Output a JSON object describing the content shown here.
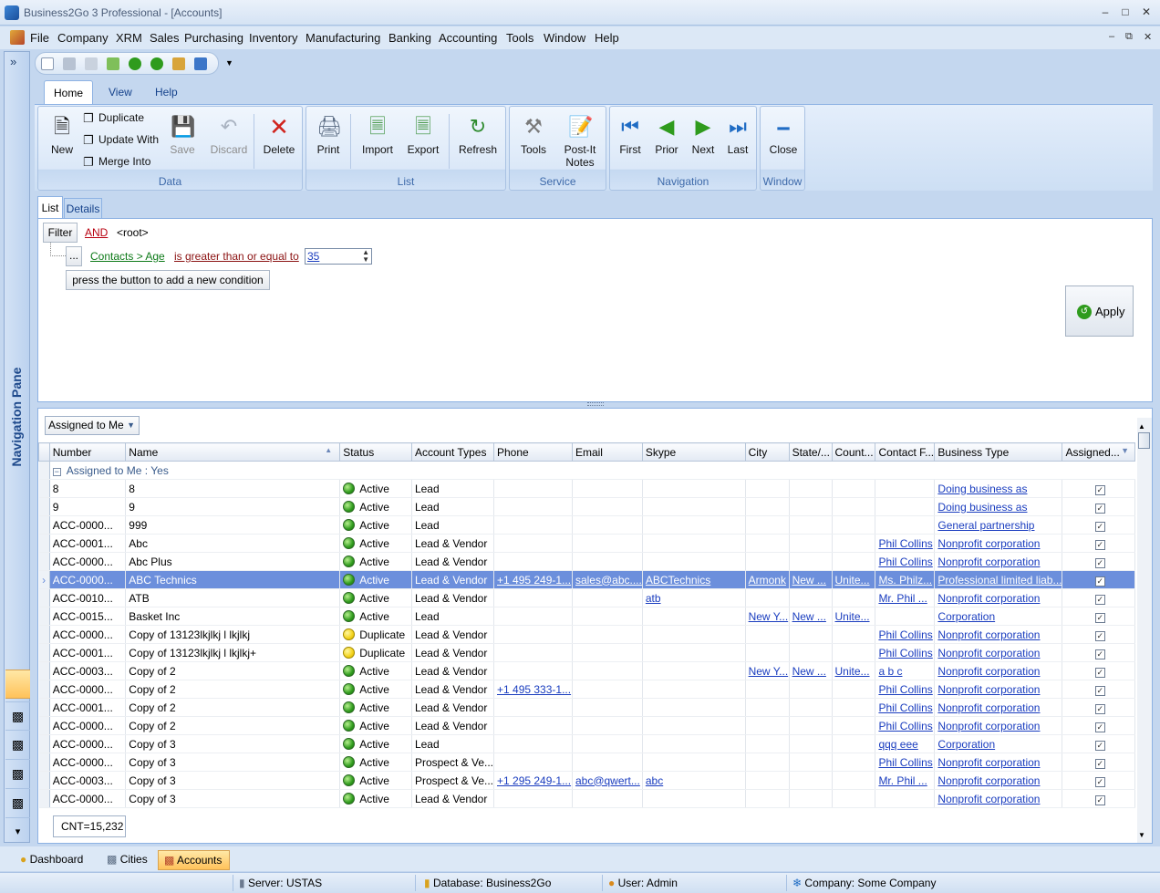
{
  "window": {
    "title": "Business2Go 3 Professional - [Accounts]",
    "min": "–",
    "max": "□",
    "close": "✕"
  },
  "menu": [
    "File",
    "Company",
    "XRM",
    "Sales",
    "Purchasing",
    "Inventory",
    "Manufacturing",
    "Banking",
    "Accounting",
    "Tools",
    "Window",
    "Help"
  ],
  "mdi": {
    "min": "–",
    "restore": "⧉",
    "close": "✕"
  },
  "nav_pane": {
    "label": "Navigation Pane",
    "expand": "»",
    "more": "▾"
  },
  "ribbon": {
    "tabs": [
      "Home",
      "View",
      "Help"
    ],
    "groups": {
      "data": {
        "label": "Data",
        "new": "New",
        "duplicate": "Duplicate",
        "update_with": "Update With",
        "merge_into": "Merge Into",
        "save": "Save",
        "discard": "Discard",
        "delete": "Delete"
      },
      "list": {
        "label": "List",
        "print": "Print",
        "import": "Import",
        "export": "Export",
        "refresh": "Refresh"
      },
      "service": {
        "label": "Service",
        "tools": "Tools",
        "postit_1": "Post-It",
        "postit_2": "Notes"
      },
      "navigation": {
        "label": "Navigation",
        "first": "First",
        "prior": "Prior",
        "next": "Next",
        "last": "Last"
      },
      "window": {
        "label": "Window",
        "close": "Close"
      }
    }
  },
  "view_tabs": {
    "list": "List",
    "details": "Details"
  },
  "filter": {
    "button": "Filter",
    "operator": "AND",
    "root": "<root>",
    "field": "Contacts > Age",
    "condition": "is greater than or equal to",
    "value": "35",
    "dots": "...",
    "add_condition": "press the button to add a new condition",
    "apply": "Apply"
  },
  "grid": {
    "group_dropdown": "Assigned to Me",
    "columns": [
      "Number",
      "Name",
      "Status",
      "Account Types",
      "Phone",
      "Email",
      "Skype",
      "City",
      "State/...",
      "Count...",
      "Contact F...",
      "Business Type",
      "Assigned..."
    ],
    "group_row": "Assigned to Me : Yes",
    "rows": [
      {
        "number": "8",
        "name": "8",
        "status": "Active",
        "types": "Lead",
        "phone": "",
        "email": "",
        "skype": "",
        "city": "",
        "state": "",
        "country": "",
        "contact": "",
        "business": "Doing business as"
      },
      {
        "number": "9",
        "name": "9",
        "status": "Active",
        "types": "Lead",
        "phone": "",
        "email": "",
        "skype": "",
        "city": "",
        "state": "",
        "country": "",
        "contact": "",
        "business": "Doing business as"
      },
      {
        "number": "ACC-0000...",
        "name": "999",
        "status": "Active",
        "types": "Lead",
        "phone": "",
        "email": "",
        "skype": "",
        "city": "",
        "state": "",
        "country": "",
        "contact": "",
        "business": "General partnership"
      },
      {
        "number": "ACC-0001...",
        "name": "Abc",
        "status": "Active",
        "types": "Lead & Vendor",
        "phone": "",
        "email": "",
        "skype": "",
        "city": "",
        "state": "",
        "country": "",
        "contact": "Phil Collins",
        "business": "Nonprofit corporation"
      },
      {
        "number": "ACC-0000...",
        "name": "Abc Plus",
        "status": "Active",
        "types": "Lead & Vendor",
        "phone": "",
        "email": "",
        "skype": "",
        "city": "",
        "state": "",
        "country": "",
        "contact": "Phil Collins",
        "business": "Nonprofit corporation"
      },
      {
        "number": "ACC-0000...",
        "name": "ABC Technics",
        "status": "Active",
        "types": "Lead & Vendor",
        "phone": "+1 495 249-1...",
        "email": "sales@abc....",
        "skype": "ABCTechnics",
        "city": "Armonk",
        "state": "New ...",
        "country": "Unite...",
        "contact": "Ms. Philz...",
        "business": "Professional limited liab...",
        "selected": true
      },
      {
        "number": "ACC-0010...",
        "name": "ATB",
        "status": "Active",
        "types": "Lead & Vendor",
        "phone": "",
        "email": "",
        "skype": "atb",
        "city": "",
        "state": "",
        "country": "",
        "contact": "Mr. Phil ...",
        "business": "Nonprofit corporation"
      },
      {
        "number": "ACC-0015...",
        "name": "Basket Inc",
        "status": "Active",
        "types": "Lead",
        "phone": "",
        "email": "",
        "skype": "",
        "city": "New Y...",
        "state": "New ...",
        "country": "Unite...",
        "contact": "",
        "business": "Corporation"
      },
      {
        "number": "ACC-0000...",
        "name": "Copy of 13123lkjlkj l lkjlkj",
        "status": "Duplicate",
        "types": "Lead & Vendor",
        "phone": "",
        "email": "",
        "skype": "",
        "city": "",
        "state": "",
        "country": "",
        "contact": "Phil Collins",
        "business": "Nonprofit corporation"
      },
      {
        "number": "ACC-0001...",
        "name": "Copy of 13123lkjlkj l lkjlkj+",
        "status": "Duplicate",
        "types": "Lead & Vendor",
        "phone": "",
        "email": "",
        "skype": "",
        "city": "",
        "state": "",
        "country": "",
        "contact": "Phil Collins",
        "business": "Nonprofit corporation"
      },
      {
        "number": "ACC-0003...",
        "name": "Copy of 2",
        "status": "Active",
        "types": "Lead & Vendor",
        "phone": "",
        "email": "",
        "skype": "",
        "city": "New Y...",
        "state": "New ...",
        "country": "Unite...",
        "contact": "a b c",
        "business": "Nonprofit corporation"
      },
      {
        "number": "ACC-0000...",
        "name": "Copy of 2",
        "status": "Active",
        "types": "Lead & Vendor",
        "phone": "+1 495 333-1...",
        "email": "",
        "skype": "",
        "city": "",
        "state": "",
        "country": "",
        "contact": "Phil Collins",
        "business": "Nonprofit corporation"
      },
      {
        "number": "ACC-0001...",
        "name": "Copy of 2",
        "status": "Active",
        "types": "Lead & Vendor",
        "phone": "",
        "email": "",
        "skype": "",
        "city": "",
        "state": "",
        "country": "",
        "contact": "Phil Collins",
        "business": "Nonprofit corporation"
      },
      {
        "number": "ACC-0000...",
        "name": "Copy of 2",
        "status": "Active",
        "types": "Lead & Vendor",
        "phone": "",
        "email": "",
        "skype": "",
        "city": "",
        "state": "",
        "country": "",
        "contact": "Phil Collins",
        "business": "Nonprofit corporation"
      },
      {
        "number": "ACC-0000...",
        "name": "Copy of 3",
        "status": "Active",
        "types": "Lead",
        "phone": "",
        "email": "",
        "skype": "",
        "city": "",
        "state": "",
        "country": "",
        "contact": "qqq eee",
        "business": "Corporation"
      },
      {
        "number": "ACC-0000...",
        "name": "Copy of 3",
        "status": "Active",
        "types": "Prospect & Ve...",
        "phone": "",
        "email": "",
        "skype": "",
        "city": "",
        "state": "",
        "country": "",
        "contact": "Phil Collins",
        "business": "Nonprofit corporation"
      },
      {
        "number": "ACC-0003...",
        "name": "Copy of 3",
        "status": "Active",
        "types": "Prospect & Ve...",
        "phone": "+1 295 249-1...",
        "email": "abc@qwert...",
        "skype": "abc",
        "city": "",
        "state": "",
        "country": "",
        "contact": "Mr. Phil ...",
        "business": "Nonprofit corporation"
      },
      {
        "number": "ACC-0000...",
        "name": "Copy of 3",
        "status": "Active",
        "types": "Lead & Vendor",
        "phone": "",
        "email": "",
        "skype": "",
        "city": "",
        "state": "",
        "country": "",
        "contact": "",
        "business": "Nonprofit corporation"
      }
    ],
    "count": "CNT=15,232"
  },
  "doc_tabs": [
    "Dashboard",
    "Cities",
    "Accounts"
  ],
  "status": {
    "server": "Server: USTAS",
    "database": "Database: Business2Go",
    "user": "User: Admin",
    "company": "Company: Some Company"
  }
}
